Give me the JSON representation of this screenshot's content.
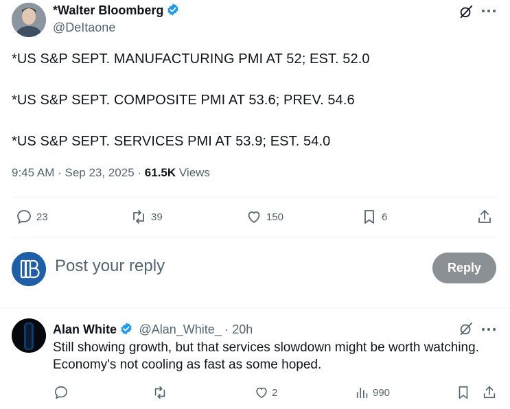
{
  "tweet": {
    "display_name": "*Walter Bloomberg",
    "handle": "@DeItaone",
    "lines": [
      "*US S&P SEPT. MANUFACTURING PMI AT 52; EST. 52.0",
      "*US S&P SEPT. COMPOSITE PMI AT 53.6; PREV. 54.6",
      "*US S&P SEPT. SERVICES PMI AT 53.9; EST. 54.0"
    ],
    "time": "9:45 AM",
    "date": "Sep 23, 2025",
    "views_count": "61.5K",
    "views_label": "Views",
    "stats": {
      "replies": "23",
      "reposts": "39",
      "likes": "150",
      "bookmarks": "6"
    }
  },
  "compose": {
    "placeholder": "Post your reply",
    "button_label": "Reply"
  },
  "reply": {
    "display_name": "Alan White",
    "handle": "@Alan_White_",
    "time": "20h",
    "lines": [
      "Still showing growth, but that services slowdown might be worth watching.",
      "Economy's not cooling as fast as some hoped."
    ],
    "stats": {
      "likes": "2",
      "views": "990"
    }
  },
  "colors": {
    "accent_blue": "#1d9bf0",
    "muted": "#536471",
    "reply_button": "#8b9094"
  }
}
